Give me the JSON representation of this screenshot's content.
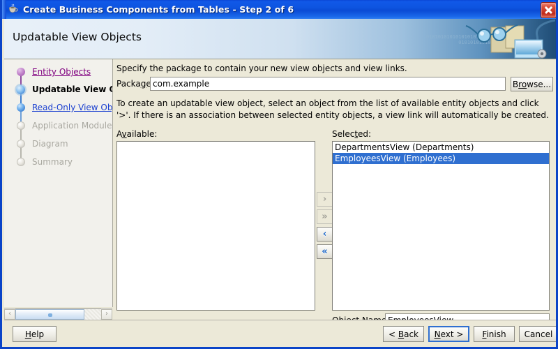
{
  "window": {
    "title": "Create Business Components from Tables - Step 2 of 6",
    "app_icon": "coffee-cup-icon",
    "close_label": "×",
    "border_color": "#0b44c8",
    "titlebar_color": "#0d54e0"
  },
  "banner": {
    "heading": "Updatable View Objects",
    "binary_line_1": "010101010101010101010101",
    "binary_line_2": "0101010101010"
  },
  "sidebar": {
    "steps": [
      {
        "label": "Entity Objects",
        "state": "visited"
      },
      {
        "label": "Updatable View Obje",
        "state": "current"
      },
      {
        "label": "Read-Only View Objects",
        "state": "link"
      },
      {
        "label": "Application Module",
        "state": "disabled"
      },
      {
        "label": "Diagram",
        "state": "disabled"
      },
      {
        "label": "Summary",
        "state": "disabled"
      }
    ],
    "scrollbar": {
      "left_arrow": "‹",
      "right_arrow": "›"
    }
  },
  "main": {
    "intro_text": "Specify the package to contain your new view objects and view links.",
    "package": {
      "label": "Packa",
      "label_mnemonic": "g",
      "label_tail": "e:",
      "value": "com.example",
      "placeholder": ""
    },
    "browse": {
      "head": "B",
      "mnemonic": "ro",
      "tail": "wse..."
    },
    "description": "To create an updatable view object, select an object from the list of available entity objects and click '>'.  If there is an association between selected entity objects, a view link will automatically be created.",
    "available": {
      "label_head": "A",
      "label_mnemonic": "v",
      "label_tail": "ailable:",
      "items": []
    },
    "selected": {
      "label_head": "Selec",
      "label_mnemonic": "t",
      "label_tail": "ed:",
      "items": [
        {
          "text": "DepartmentsView (Departments)",
          "selected": false
        },
        {
          "text": "EmployeesView (Employees)",
          "selected": true
        }
      ],
      "highlight_color": "#2f6fd0"
    },
    "transfer_buttons": [
      {
        "name": "move-right-button",
        "glyph": "›",
        "enabled": false
      },
      {
        "name": "move-all-right-button",
        "glyph": "»",
        "enabled": false
      },
      {
        "name": "move-left-button",
        "glyph": "‹",
        "enabled": true
      },
      {
        "name": "move-all-left-button",
        "glyph": "«",
        "enabled": true
      }
    ],
    "object_name": {
      "label": "Object Name:",
      "value": "EmployeesView"
    }
  },
  "footer": {
    "help": {
      "head": "",
      "mnemonic": "H",
      "tail": "elp"
    },
    "back": {
      "head": "< ",
      "mnemonic": "B",
      "tail": "ack"
    },
    "next": {
      "head": "",
      "mnemonic": "N",
      "tail": "ext >"
    },
    "finish": {
      "head": "",
      "mnemonic": "F",
      "tail": "inish"
    },
    "cancel": {
      "head": "Cancel",
      "mnemonic": "",
      "tail": ""
    }
  }
}
